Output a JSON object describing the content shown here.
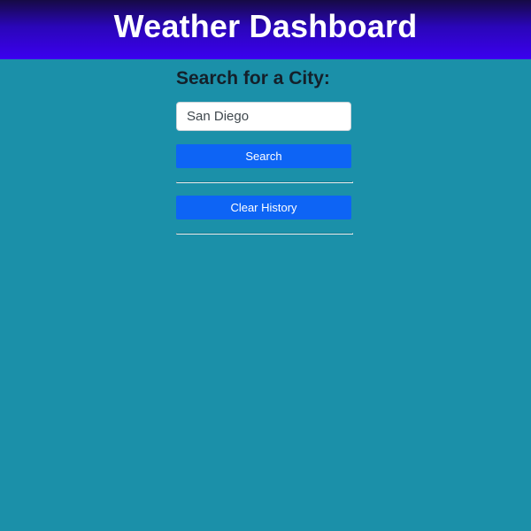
{
  "header": {
    "title": "Weather Dashboard"
  },
  "search": {
    "heading": "Search for a City:",
    "input_value": "San Diego",
    "search_label": "Search",
    "clear_label": "Clear History"
  },
  "colors": {
    "background": "#1b90a9",
    "header_gradient_top": "#160a44",
    "header_gradient_bottom": "#3b00f0",
    "button": "#0d64f5"
  }
}
